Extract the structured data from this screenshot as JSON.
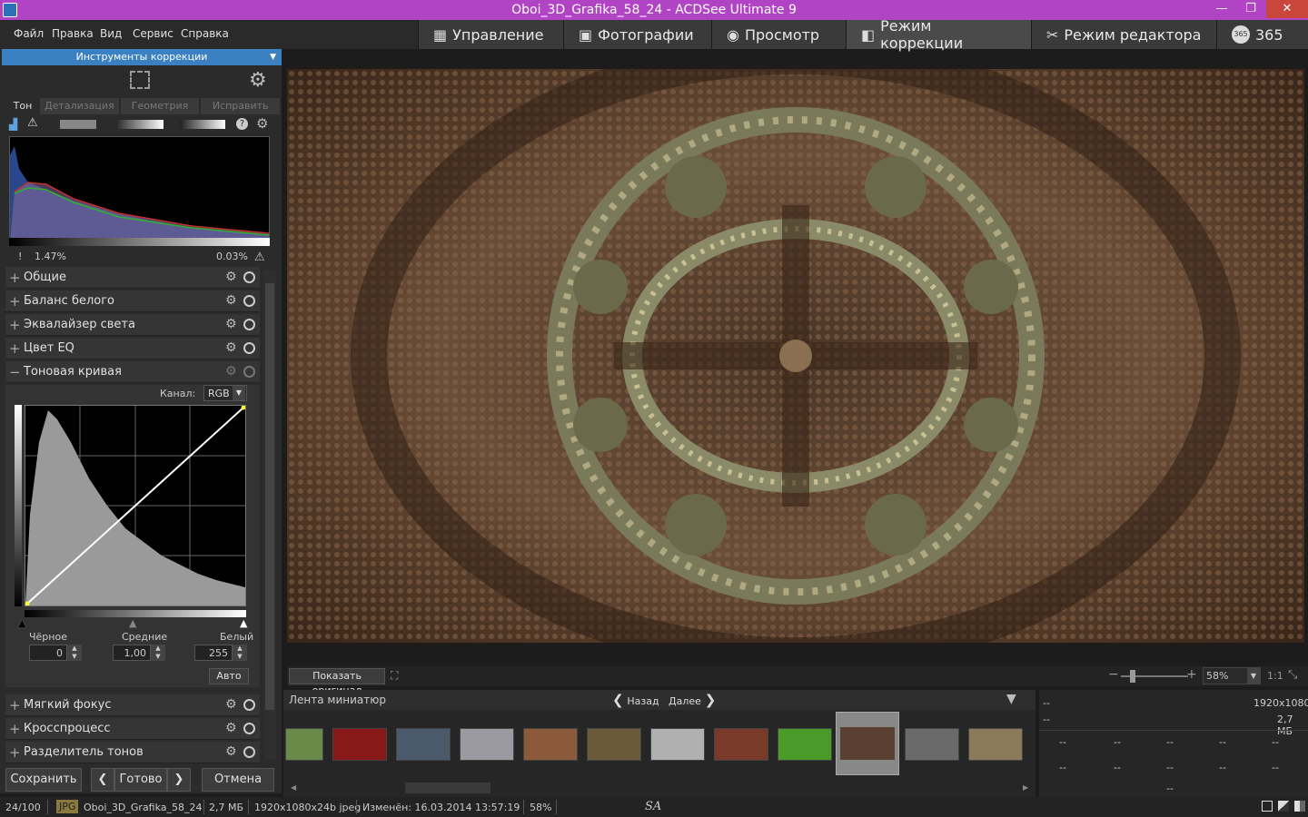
{
  "window": {
    "title": "Oboi_3D_Grafika_58_24 - ACDSee Ultimate 9",
    "min": "—",
    "max": "❐",
    "close": "✕"
  },
  "menu": [
    "Файл",
    "Правка",
    "Вид",
    "Сервис",
    "Справка"
  ],
  "modes": [
    {
      "label": "Управление",
      "icon": "grid-icon"
    },
    {
      "label": "Фотографии",
      "icon": "photos-icon"
    },
    {
      "label": "Просмотр",
      "icon": "eye-icon"
    },
    {
      "label": "Режим коррекции",
      "icon": "develop-icon"
    },
    {
      "label": "Режим редактора",
      "icon": "edit-icon"
    },
    {
      "label": "365",
      "icon": "cloud-365-icon"
    }
  ],
  "panel": {
    "title": "Инструменты коррекции",
    "tabs": [
      "Тон",
      "Детализация",
      "Геометрия",
      "Исправить"
    ],
    "clip_left": "1.47%",
    "clip_right": "0.03%",
    "sections_top": [
      "Общие",
      "Баланс белого",
      "Эквалайзер света",
      "Цвет EQ"
    ],
    "curve": {
      "title": "Тоновая кривая",
      "channel_label": "Канал:",
      "channel_value": "RGB",
      "black_label": "Чёрное",
      "mid_label": "Средние",
      "white_label": "Белый",
      "black_value": "0",
      "mid_value": "1,00",
      "white_value": "255",
      "auto_label": "Авто"
    },
    "sections_bottom": [
      "Мягкий фокус",
      "Кросспроцесс",
      "Разделитель тонов"
    ],
    "save_label": "Сохранить",
    "done_label": "Готово",
    "cancel_label": "Отмена"
  },
  "viewbar": {
    "show_original": "Показать оригинал",
    "zoom": "58%",
    "one_to_one": "1:1"
  },
  "filmstrip": {
    "title": "Лента миниатюр",
    "back": "Назад",
    "next": "Далее"
  },
  "info": {
    "resolution": "1920x1080",
    "size": "2,7 МБ",
    "dash": "--"
  },
  "status": {
    "count": "24/100",
    "format": "JPG",
    "filename": "Oboi_3D_Grafika_58_24",
    "filesize": "2,7 МБ",
    "dims": "1920x1080x24b jpeg",
    "modified": "Изменён: 16.03.2014 13:57:19",
    "zoom": "58%",
    "sa": "SA"
  },
  "colors": {
    "titlebar": "#b044c4",
    "accent": "#3b80c0"
  }
}
